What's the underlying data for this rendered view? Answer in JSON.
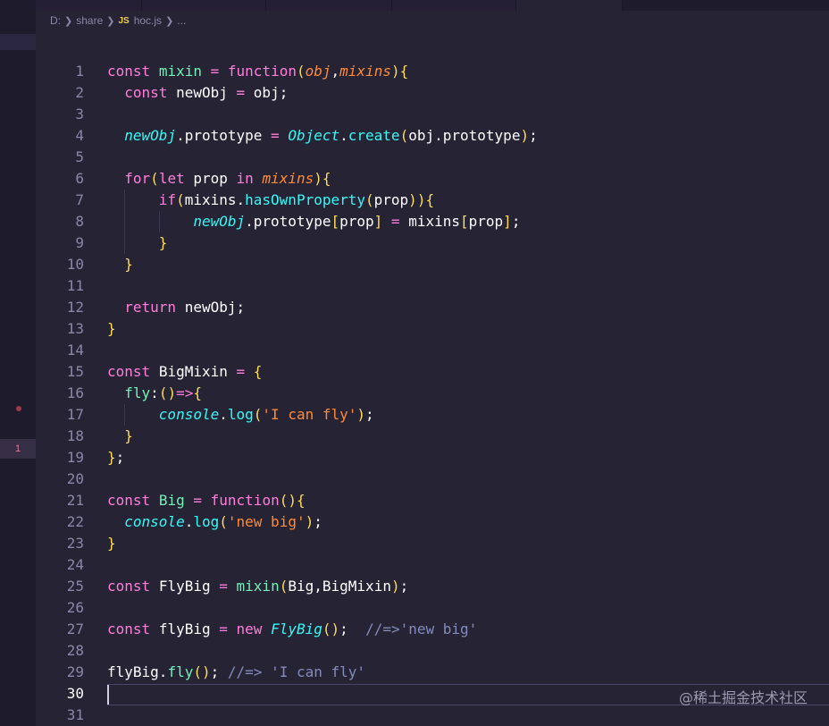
{
  "breadcrumb": {
    "drive": "D:",
    "folder": "share",
    "file_badge": "JS",
    "file": "hoc.js",
    "ellipsis": "..."
  },
  "editor": {
    "current_line": 30,
    "line_numbers": [
      "1",
      "2",
      "3",
      "4",
      "5",
      "6",
      "7",
      "8",
      "9",
      "10",
      "11",
      "12",
      "13",
      "14",
      "15",
      "16",
      "17",
      "18",
      "19",
      "20",
      "21",
      "22",
      "23",
      "24",
      "25",
      "26",
      "27",
      "28",
      "29",
      "30",
      "31"
    ],
    "code": [
      "const mixin = function(obj,mixins){",
      "  const newObj = obj;",
      "",
      "  newObj.prototype = Object.create(obj.prototype);",
      "",
      "  for(let prop in mixins){",
      "      if(mixins.hasOwnProperty(prop)){",
      "          newObj.prototype[prop] = mixins[prop];",
      "      }",
      "  }",
      "",
      "  return newObj;",
      "}",
      "",
      "const BigMixin = {",
      "  fly:()=>{",
      "      console.log('I can fly');",
      "  }",
      "};",
      "",
      "const Big = function(){",
      "  console.log('new big');",
      "}",
      "",
      "const FlyBig = mixin(Big,BigMixin);",
      "",
      "const flyBig = new FlyBig();  //=>'new big'",
      "",
      "flyBig.fly(); //=> 'I can fly'",
      "",
      ""
    ]
  },
  "gutter": {
    "problem_count": "1"
  },
  "watermark": "@稀土掘金技术社区",
  "colors": {
    "background": "#262335",
    "keyword": "#fede5d",
    "function": "#36f9f6",
    "string": "#ff8b39",
    "property": "#72f1b8",
    "pink": "#ff7edb",
    "comment": "#848bbd"
  }
}
